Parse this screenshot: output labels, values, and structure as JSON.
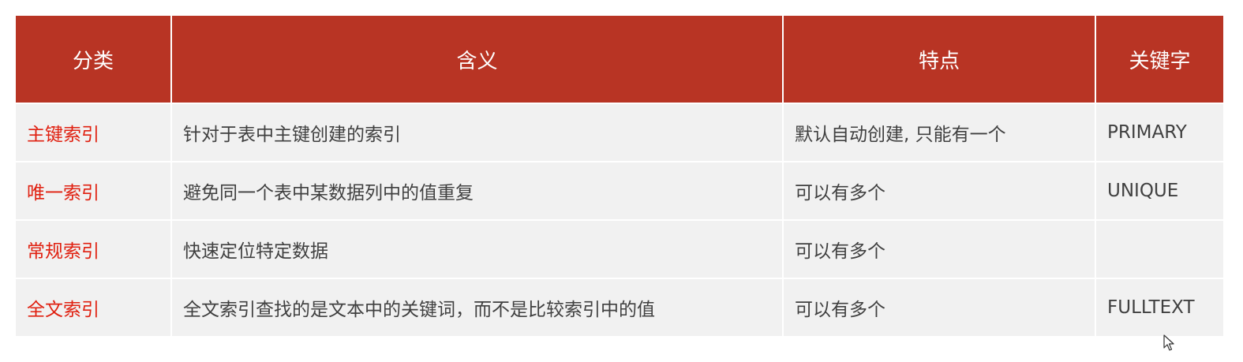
{
  "table": {
    "headers": [
      "分类",
      "含义",
      "特点",
      "关键字"
    ],
    "rows": [
      {
        "category": "主键索引",
        "meaning": "针对于表中主键创建的索引",
        "feature": "默认自动创建, 只能有一个",
        "keyword": "PRIMARY"
      },
      {
        "category": "唯一索引",
        "meaning": "避免同一个表中某数据列中的值重复",
        "feature": "可以有多个",
        "keyword": "UNIQUE"
      },
      {
        "category": "常规索引",
        "meaning": "快速定位特定数据",
        "feature": "可以有多个",
        "keyword": ""
      },
      {
        "category": "全文索引",
        "meaning": "全文索引查找的是文本中的关键词，而不是比较索引中的值",
        "feature": "可以有多个",
        "keyword": "FULLTEXT"
      }
    ]
  },
  "colors": {
    "header_bg": "#b83424",
    "header_text": "#ffffff",
    "category_text": "#e02010",
    "cell_bg": "#f1f1f1",
    "cell_text": "#404040"
  },
  "icons": {
    "cursor": "mouse-pointer-icon"
  }
}
